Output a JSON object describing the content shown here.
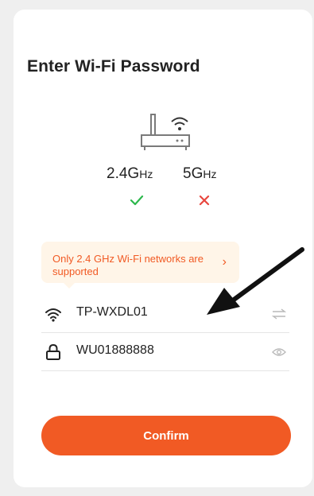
{
  "page": {
    "title": "Enter Wi-Fi Password"
  },
  "bands": {
    "band_24_main": "2.4G",
    "band_24_unit": "Hz",
    "band_5_main": "5G",
    "band_5_unit": "Hz",
    "band_24_status_icon": "check-icon",
    "band_5_status_icon": "cross-icon"
  },
  "notice": {
    "text": "Only 2.4 GHz Wi-Fi networks are supported",
    "chevron": "›"
  },
  "ssid_field": {
    "icon": "wifi-icon",
    "value": "TP-WXDL01",
    "action_icon": "switch-network-icon"
  },
  "password_field": {
    "icon": "lock-icon",
    "value": "WU01888888",
    "action_icon": "eye-icon"
  },
  "confirm_button": {
    "label": "Confirm"
  },
  "colors": {
    "accent": "#f15a24",
    "success": "#2db84d",
    "error": "#e8473f",
    "notice_bg": "#fff5e8",
    "annotation_arrow": "#111111"
  }
}
